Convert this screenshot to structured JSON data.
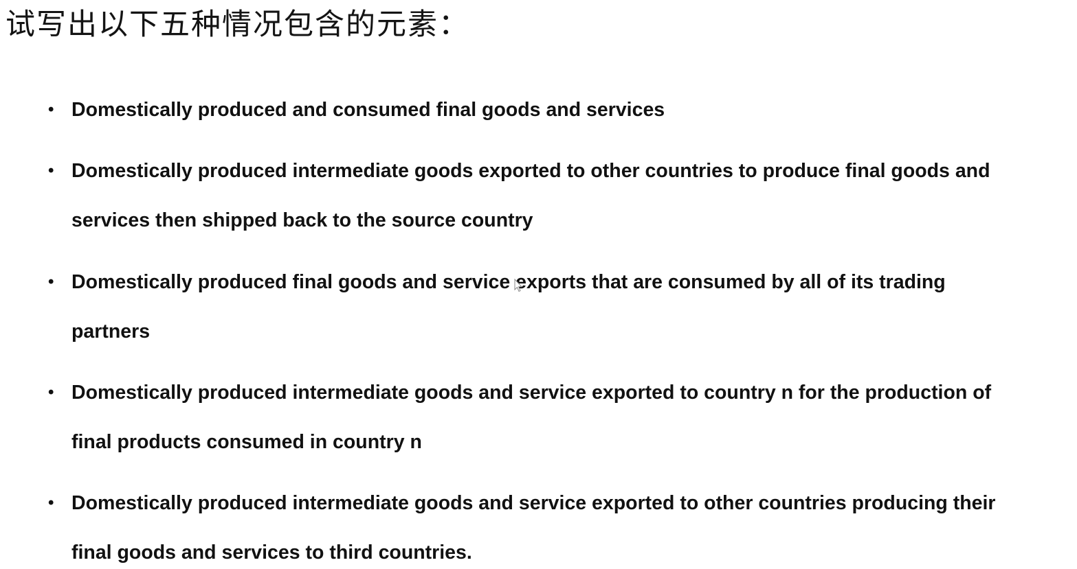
{
  "title": "试写出以下五种情况包含的元素：",
  "bullet_symbol": "•",
  "items": [
    {
      "lines": [
        "Domestically produced and consumed final goods and services"
      ]
    },
    {
      "lines": [
        "Domestically produced intermediate goods exported to other countries to produce final goods and",
        "services then shipped back to the source country"
      ]
    },
    {
      "lines": [
        "Domestically produced final goods and service exports that are consumed by all of its trading",
        "partners"
      ]
    },
    {
      "lines": [
        "Domestically produced intermediate goods and service exported to country n for the production of",
        "final products consumed in country n"
      ]
    },
    {
      "lines": [
        "Domestically produced intermediate goods and service exported to other countries producing their",
        "final goods and services to third countries."
      ]
    }
  ],
  "icons": {
    "cursor": "mouse-pointer-icon"
  }
}
